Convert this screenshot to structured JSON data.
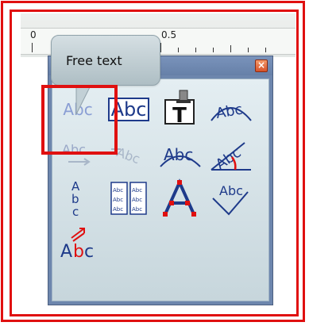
{
  "ruler": {
    "label_start": "0",
    "label_mid": "0.5"
  },
  "palette": {
    "close_label": "×",
    "tools": [
      {
        "name": "free-text-tool",
        "label": "Abc"
      },
      {
        "name": "text-frame-tool",
        "label": "Abc"
      },
      {
        "name": "vertical-text-tool",
        "label": "T"
      },
      {
        "name": "curved-text-tool",
        "label": "Abc"
      },
      {
        "name": "text-on-path-tool",
        "label": "Abc"
      },
      {
        "name": "text-on-wave-tool",
        "label": "Abc"
      },
      {
        "name": "text-arc-tool",
        "label": "Abc"
      },
      {
        "name": "text-angle-tool",
        "label": "Abc"
      },
      {
        "name": "vertical-stack-text-tool",
        "label": "Abc"
      },
      {
        "name": "table-text-tool",
        "label": "Abc"
      },
      {
        "name": "outline-letter-tool",
        "label": "A"
      },
      {
        "name": "text-v-shape-tool",
        "label": "Abc"
      },
      {
        "name": "text-swap-tool",
        "label": "Abc"
      }
    ]
  },
  "tooltip": {
    "text": "Free text"
  },
  "colors": {
    "highlight": "#e01010",
    "palette_frame": "#6d86ad",
    "tool_text": "#1e3a8a"
  }
}
